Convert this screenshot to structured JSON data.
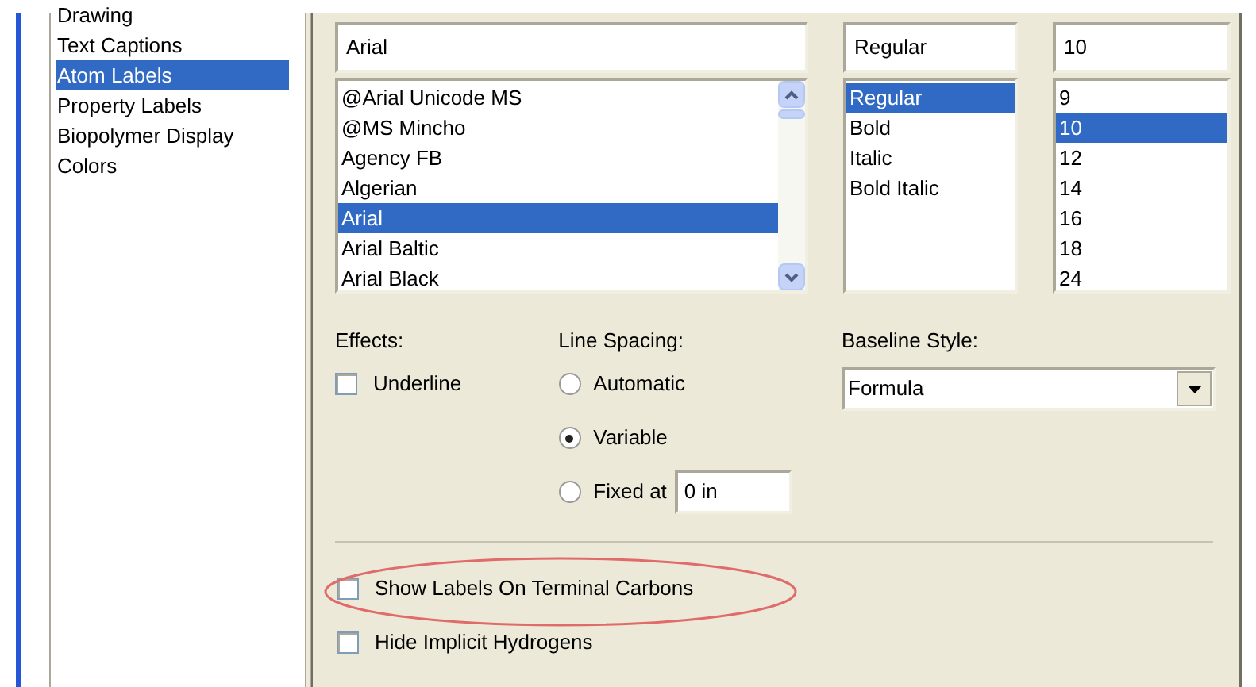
{
  "sidebar": {
    "items": [
      {
        "label": "Drawing",
        "selected": false
      },
      {
        "label": "Text Captions",
        "selected": false
      },
      {
        "label": "Atom Labels",
        "selected": true
      },
      {
        "label": "Property Labels",
        "selected": false
      },
      {
        "label": "Biopolymer Display",
        "selected": false
      },
      {
        "label": "Colors",
        "selected": false
      }
    ]
  },
  "font": {
    "value": "Arial",
    "items": [
      {
        "label": "@Arial Unicode MS",
        "selected": false
      },
      {
        "label": "@MS Mincho",
        "selected": false
      },
      {
        "label": "Agency FB",
        "selected": false
      },
      {
        "label": "Algerian",
        "selected": false
      },
      {
        "label": "Arial",
        "selected": true
      },
      {
        "label": "Arial Baltic",
        "selected": false
      },
      {
        "label": "Arial Black",
        "selected": false
      }
    ]
  },
  "style": {
    "value": "Regular",
    "items": [
      {
        "label": "Regular",
        "selected": true
      },
      {
        "label": "Bold",
        "selected": false
      },
      {
        "label": "Italic",
        "selected": false
      },
      {
        "label": "Bold Italic",
        "selected": false
      }
    ]
  },
  "size": {
    "value": "10",
    "items": [
      {
        "label": "9",
        "selected": false
      },
      {
        "label": "10",
        "selected": true
      },
      {
        "label": "12",
        "selected": false
      },
      {
        "label": "14",
        "selected": false
      },
      {
        "label": "16",
        "selected": false
      },
      {
        "label": "18",
        "selected": false
      },
      {
        "label": "24",
        "selected": false
      }
    ]
  },
  "effects": {
    "label": "Effects:",
    "options": [
      {
        "label": "Underline",
        "checked": false
      }
    ]
  },
  "line_spacing": {
    "label": "Line Spacing:",
    "options": [
      {
        "label": "Automatic",
        "selected": false
      },
      {
        "label": "Variable",
        "selected": true
      },
      {
        "label": "Fixed at",
        "selected": false,
        "value": "0 in"
      }
    ]
  },
  "baseline_style": {
    "label": "Baseline Style:",
    "value": "Formula"
  },
  "options": [
    {
      "label": "Show Labels On Terminal Carbons",
      "checked": false,
      "highlighted": true
    },
    {
      "label": "Hide Implicit Hydrogens",
      "checked": false,
      "highlighted": false
    }
  ]
}
